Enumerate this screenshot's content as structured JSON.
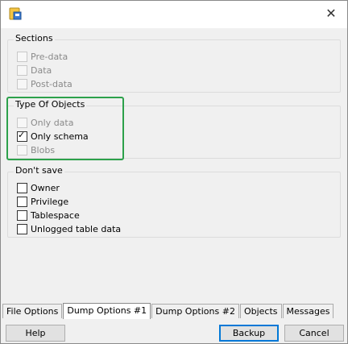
{
  "window": {
    "app_icon": "database-backup-icon",
    "close_icon": "close-icon"
  },
  "sections": {
    "title": "Sections",
    "items": [
      {
        "label": "Pre-data",
        "checked": false,
        "enabled": false
      },
      {
        "label": "Data",
        "checked": false,
        "enabled": false
      },
      {
        "label": "Post-data",
        "checked": false,
        "enabled": false
      }
    ]
  },
  "type_of_objects": {
    "title": "Type Of Objects",
    "items": [
      {
        "label": "Only data",
        "checked": false,
        "enabled": false
      },
      {
        "label": "Only schema",
        "checked": true,
        "enabled": true
      },
      {
        "label": "Blobs",
        "checked": false,
        "enabled": false
      }
    ]
  },
  "dont_save": {
    "title": "Don't save",
    "items": [
      {
        "label": "Owner",
        "checked": false,
        "enabled": true
      },
      {
        "label": "Privilege",
        "checked": false,
        "enabled": true
      },
      {
        "label": "Tablespace",
        "checked": false,
        "enabled": true
      },
      {
        "label": "Unlogged table data",
        "checked": false,
        "enabled": true
      }
    ]
  },
  "tabs": [
    "File Options",
    "Dump Options #1",
    "Dump Options #2",
    "Objects",
    "Messages"
  ],
  "active_tab": "Dump Options #1",
  "buttons": {
    "help": "Help",
    "backup": "Backup",
    "cancel": "Cancel"
  },
  "colors": {
    "highlight": "#2ca14b",
    "default_button_border": "#0078d7"
  }
}
